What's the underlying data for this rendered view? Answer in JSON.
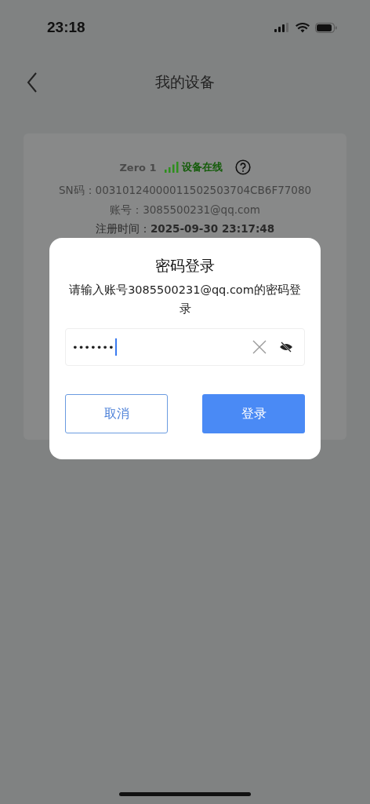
{
  "status_bar": {
    "time": "23:18"
  },
  "nav": {
    "title": "我的设备"
  },
  "device": {
    "name": "Zero 1",
    "status": "设备在线",
    "online": true,
    "sn": "SN码：00310124000011502503704CB6F77080",
    "account": "账号：3085500231@qq.com",
    "registered_label": "注册时间：",
    "registered": "2025-09-30 23:17:48"
  },
  "dialog": {
    "title": "密码登录",
    "message": "请输入账号3085500231@qq.com的密码登录",
    "password": {
      "value": "•••••••",
      "masked": true
    },
    "buttons": [
      {
        "label": "取消",
        "kind": "secondary"
      },
      {
        "label": "登录",
        "kind": "primary"
      }
    ]
  }
}
